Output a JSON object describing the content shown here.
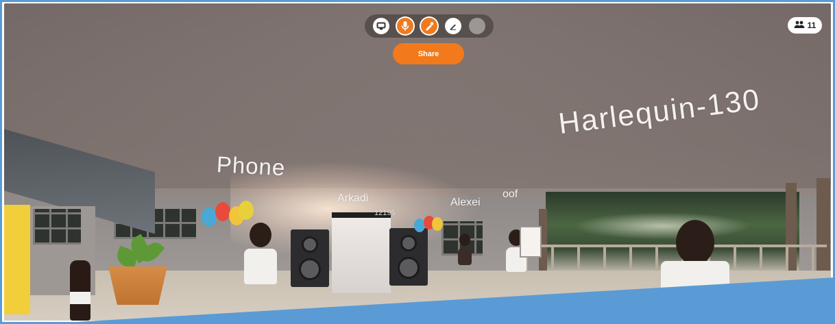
{
  "toolbar": {
    "items": [
      {
        "name": "screen-share-icon",
        "state": "default"
      },
      {
        "name": "microphone-icon",
        "state": "active"
      },
      {
        "name": "pen-tool-icon",
        "state": "active"
      },
      {
        "name": "pencil-icon",
        "state": "default"
      },
      {
        "name": "disabled-tool-icon",
        "state": "disabled"
      }
    ]
  },
  "share_button": {
    "label": "Share"
  },
  "people_badge": {
    "count": "11",
    "icon": "people-icon"
  },
  "world_labels": {
    "phone": "Phone",
    "harlequin": "Harlequin-130",
    "arkadi": "Arkadi",
    "alexei": "Alexei",
    "oof": "oof",
    "small": "12195"
  },
  "colors": {
    "accent_orange": "#f27a1a",
    "overlay_blue": "#5b9bd5"
  }
}
